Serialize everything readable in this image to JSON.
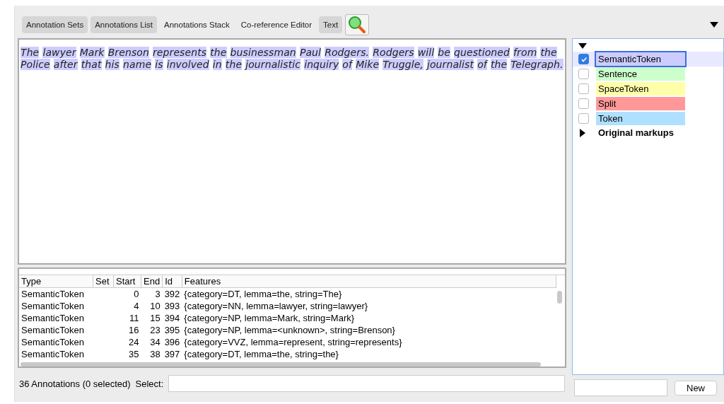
{
  "tabs": [
    {
      "label": "Annotation Sets",
      "selected": true
    },
    {
      "label": "Annotations List",
      "selected": true
    },
    {
      "label": "Annotations Stack",
      "selected": false
    },
    {
      "label": "Co-reference Editor",
      "selected": false
    },
    {
      "label": "Text",
      "selected": true
    }
  ],
  "document_text": "The lawyer Mark Brenson represents the businessman Paul Rodgers. Rodgers will be questioned from the Police after that his name is involved in the journalistic inquiry of Mike Truggle, journalist of the Telegraph.",
  "table": {
    "columns": [
      "Type",
      "Set",
      "Start",
      "End",
      "Id",
      "Features"
    ],
    "rows": [
      [
        "SemanticToken",
        "",
        "0",
        "3",
        "392",
        "{category=DT, lemma=the, string=The}"
      ],
      [
        "SemanticToken",
        "",
        "4",
        "10",
        "393",
        "{category=NN, lemma=lawyer, string=lawyer}"
      ],
      [
        "SemanticToken",
        "",
        "11",
        "15",
        "394",
        "{category=NP, lemma=Mark, string=Mark}"
      ],
      [
        "SemanticToken",
        "",
        "16",
        "23",
        "395",
        "{category=NP, lemma=<unknown>, string=Brenson}"
      ],
      [
        "SemanticToken",
        "",
        "24",
        "34",
        "396",
        "{category=VVZ, lemma=represent, string=represents}"
      ],
      [
        "SemanticToken",
        "",
        "35",
        "38",
        "397",
        "{category=DT, lemma=the, string=the}"
      ]
    ]
  },
  "status": {
    "count": "36 Annotations (0 selected)",
    "select_label": "Select:"
  },
  "annotation_types": [
    {
      "name": "SemanticToken",
      "checked": true,
      "selected": true,
      "color": "#ccccff"
    },
    {
      "name": "Sentence",
      "checked": false,
      "selected": false,
      "color": "#ccffcc"
    },
    {
      "name": "SpaceToken",
      "checked": false,
      "selected": false,
      "color": "#ffffaa"
    },
    {
      "name": "Split",
      "checked": false,
      "selected": false,
      "color": "#ff9999"
    },
    {
      "name": "Token",
      "checked": false,
      "selected": false,
      "color": "#b0e0ff"
    }
  ],
  "groups": [
    {
      "name": "Original markups",
      "expanded": false
    }
  ],
  "new_button": "New"
}
